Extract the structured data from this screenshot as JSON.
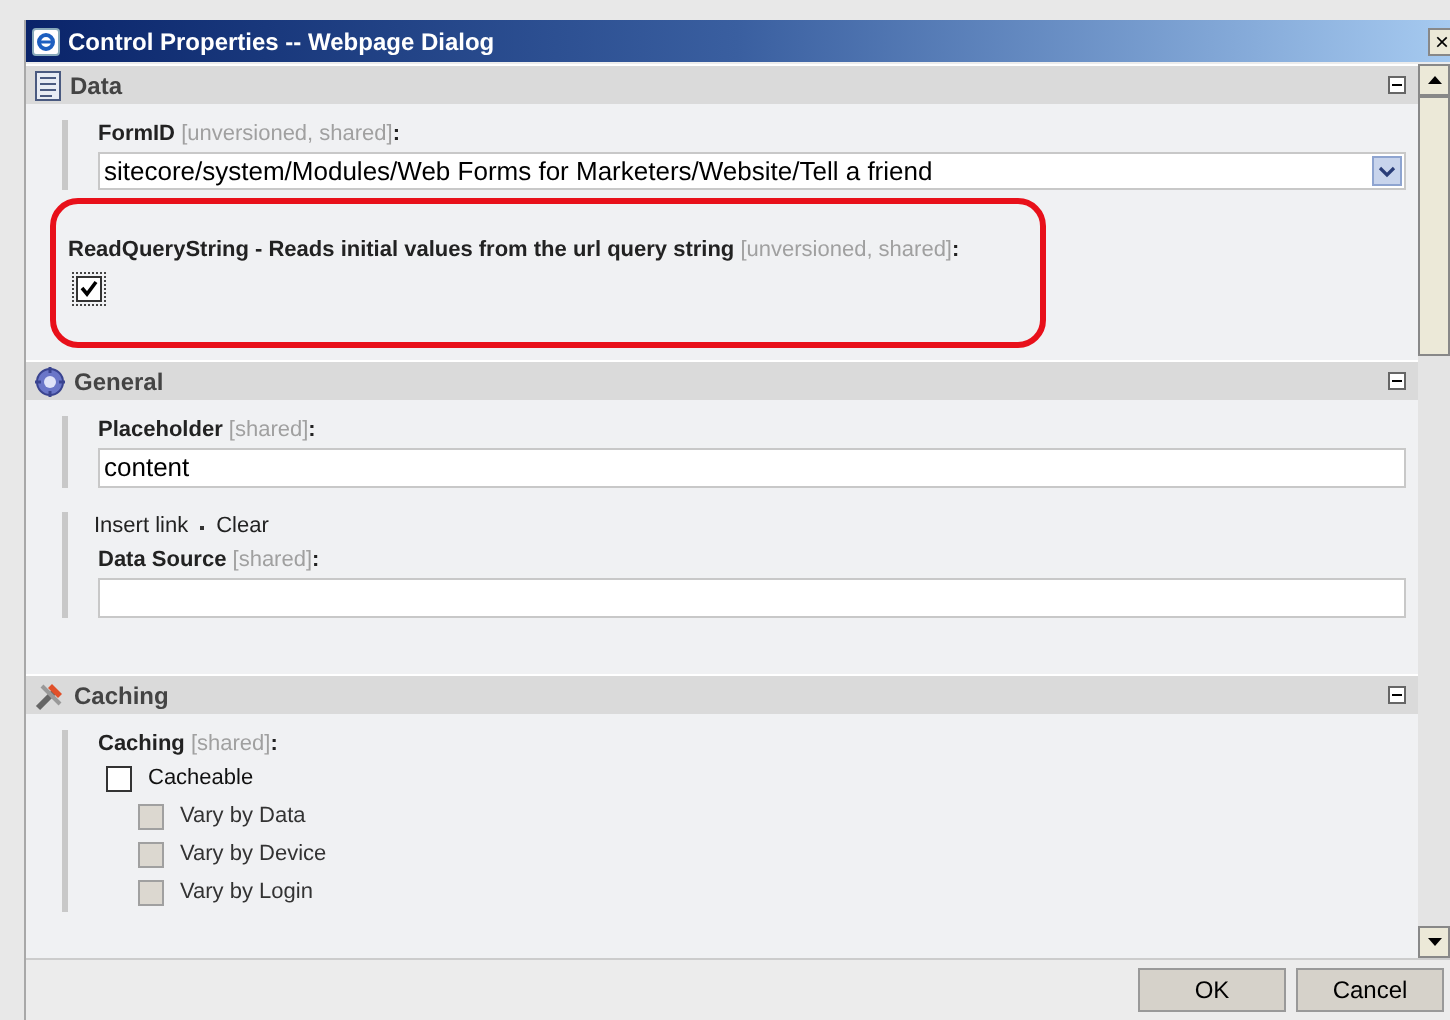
{
  "window": {
    "title": "Control Properties -- Webpage Dialog",
    "close": "×"
  },
  "sections": [
    {
      "title": "Data",
      "expanded": true,
      "fields": [
        {
          "kind": "dropdown",
          "label": "FormID",
          "meta": "[unversioned, shared]",
          "colon": ":",
          "value": "sitecore/system/Modules/Web Forms for Marketers/Website/Tell a friend",
          "highlighted": false
        },
        {
          "kind": "checkbox",
          "label": "ReadQueryString - Reads initial values from the url query string",
          "meta": "[unversioned, shared]",
          "colon": ":",
          "checked": true,
          "highlighted": true
        }
      ]
    },
    {
      "title": "General",
      "expanded": true,
      "fields": [
        {
          "kind": "text",
          "label": "Placeholder",
          "meta": "[shared]",
          "colon": ":",
          "value": "content",
          "highlighted": false
        },
        {
          "kind": "text",
          "label": "Data Source",
          "meta": "[shared]",
          "colon": ":",
          "links": [
            "Insert link",
            "Clear"
          ],
          "highlighted": false
        }
      ]
    },
    {
      "title": "Caching",
      "expanded": true,
      "fields": [
        {
          "kind": "checklist",
          "label": "Caching",
          "meta": "[shared]",
          "colon": ":",
          "highlighted": false,
          "items": [
            {
              "label": "Cacheable",
              "checked": false,
              "disabled": false,
              "children": [
                {
                  "label": "Vary by Data",
                  "checked": false,
                  "disabled": true
                },
                {
                  "label": "Vary by Device",
                  "checked": false,
                  "disabled": true
                },
                {
                  "label": "Vary by Login",
                  "checked": false,
                  "disabled": true
                }
              ]
            }
          ]
        }
      ]
    }
  ],
  "buttons": [
    "OK",
    "Cancel"
  ]
}
